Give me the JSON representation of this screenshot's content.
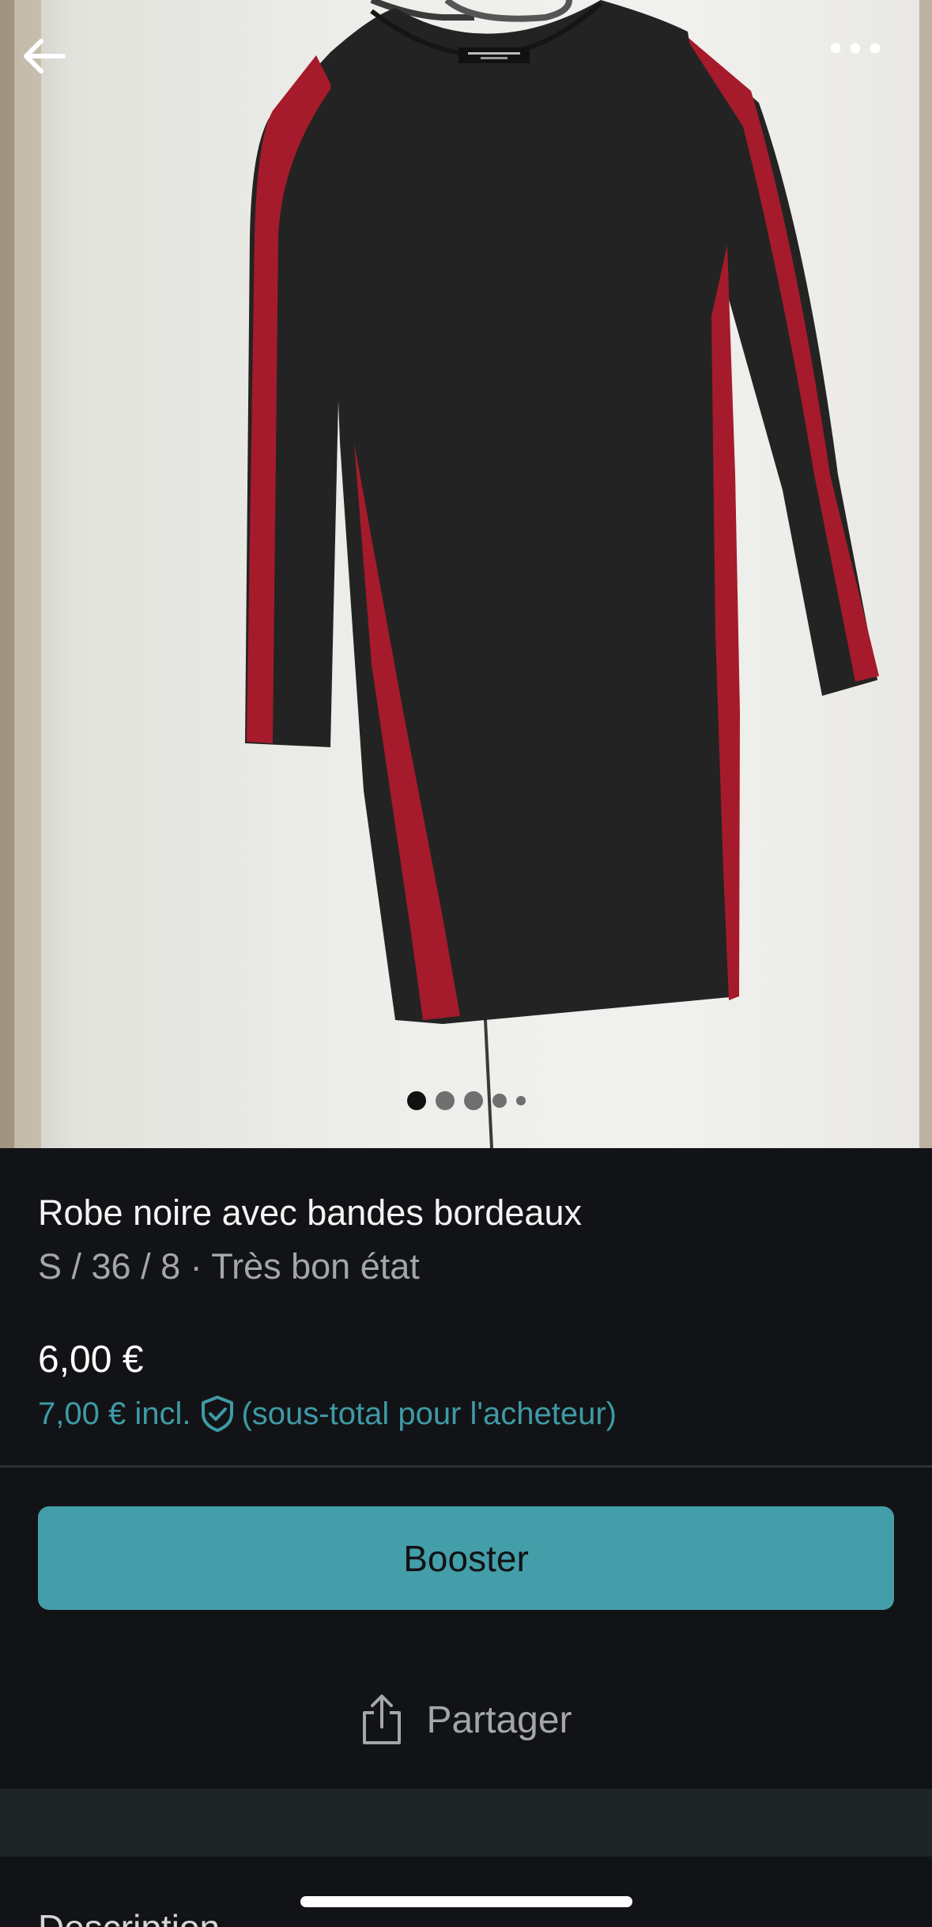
{
  "photo": {
    "image_count": 5,
    "active_index": 0,
    "alt": "Robe noire avec bandes bordeaux"
  },
  "icons": {
    "back": "arrow-left-icon",
    "more": "more-horizontal-icon",
    "buyer_protection": "shield-check-icon",
    "share": "share-icon"
  },
  "item": {
    "title": "Robe noire avec bandes bordeaux",
    "details": "S / 36 / 8 · Très bon état",
    "price": "6,00 €",
    "price_incl_prefix": "7,00 € incl.",
    "price_incl_suffix": "(sous-total pour l'acheteur)"
  },
  "actions": {
    "booster_label": "Booster",
    "share_label": "Partager"
  },
  "description": {
    "heading": "Description"
  },
  "colors": {
    "background": "#121316",
    "accent": "#449ea9",
    "link_teal": "#3e9aa6",
    "muted_text": "#a4a6a8"
  }
}
